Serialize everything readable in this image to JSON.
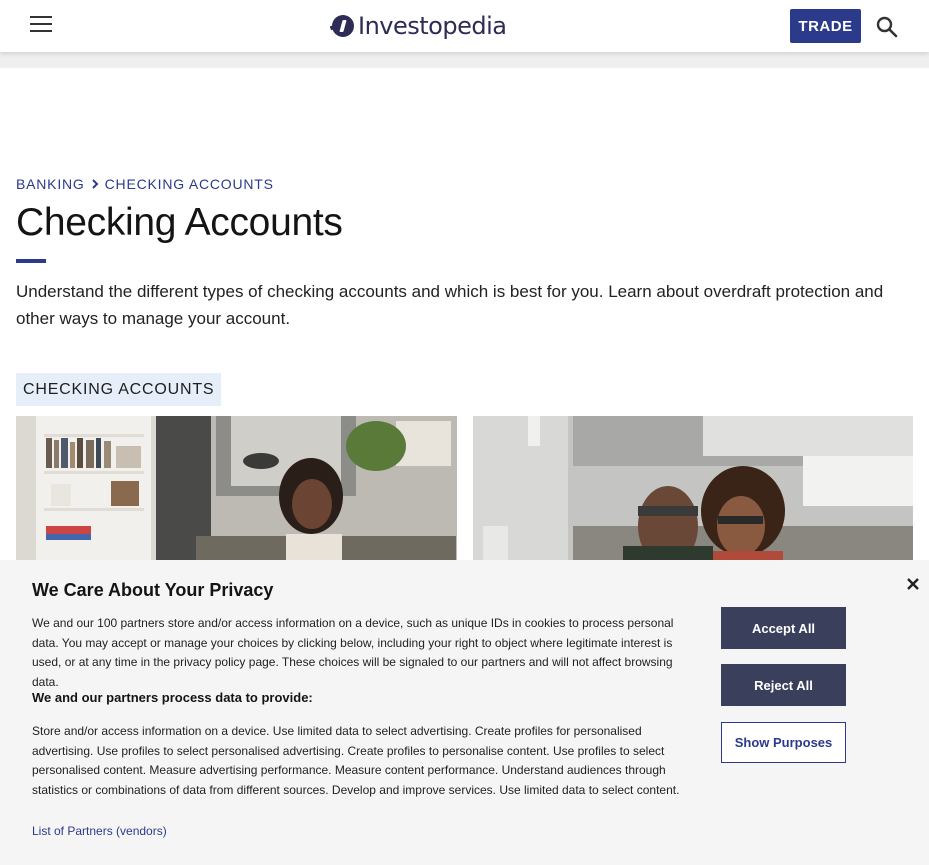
{
  "header": {
    "logo_text": "Investopedia",
    "trade_label": "TRADE",
    "menu_icon": "hamburger-menu-icon",
    "search_icon": "search-icon"
  },
  "breadcrumb": {
    "items": [
      "BANKING",
      "CHECKING ACCOUNTS"
    ]
  },
  "page": {
    "title": "Checking Accounts",
    "intro": "Understand the different types of checking accounts and which is best for you. Learn about overdraft protection and other ways to manage your account.",
    "section_tag": "CHECKING ACCOUNTS"
  },
  "privacy": {
    "title": "We Care About Your Privacy",
    "body": "We and our 100 partners store and/or access information on a device, such as unique IDs in cookies to process personal data. You may accept or manage your choices by clicking below, including your right to object where legitimate interest is used, or at any time in the privacy policy page. These choices will be signaled to our partners and will not affect browsing data.",
    "subhead": "We and our partners process data to provide:",
    "purposes": "Store and/or access information on a device. Use limited data to select advertising. Create profiles for personalised advertising. Use profiles to select personalised advertising. Create profiles to personalise content. Use profiles to select personalised content. Measure advertising performance. Measure content performance. Understand audiences through statistics or combinations of data from different sources. Develop and improve services. Use limited data to select content.",
    "partners_link": "List of Partners (vendors)",
    "accept_label": "Accept All",
    "reject_label": "Reject All",
    "purposes_label": "Show Purposes"
  },
  "colors": {
    "brand": "#2c3a8c",
    "logo": "#2c2c54",
    "button_dark": "#3a3f5c",
    "tag_bg": "#e5eef9"
  }
}
